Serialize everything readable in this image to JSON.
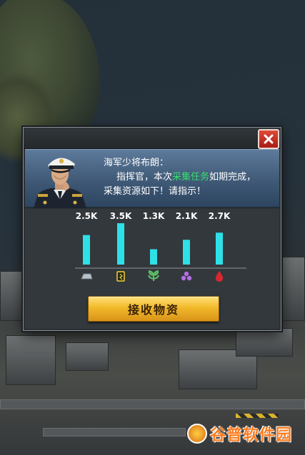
{
  "dialog": {
    "speaker": "海军少将布朗：",
    "message_line1_prefix": "指挥官，本次",
    "message_highlight": "采集任务",
    "message_line1_suffix": "如期完成，",
    "message_line2": "采集资源如下！请指示！",
    "collect_button_label": "接收物资",
    "highlight_color": "#35e06a"
  },
  "chart_data": {
    "type": "bar",
    "categories": [
      "steel",
      "oil-can",
      "food",
      "crystal",
      "blood-drop"
    ],
    "values": [
      2.5,
      3.5,
      1.3,
      2.1,
      2.7
    ],
    "value_labels": [
      "2.5K",
      "3.5K",
      "1.3K",
      "2.1K",
      "2.7K"
    ],
    "units": "K",
    "bar_color": "#2ee0e8",
    "icon_names": [
      "steel-icon",
      "fuel-icon",
      "food-icon",
      "crystal-icon",
      "blood-drop-icon"
    ]
  },
  "watermark": {
    "text": "谷普软件园"
  },
  "icons": {
    "close": "close-icon"
  }
}
